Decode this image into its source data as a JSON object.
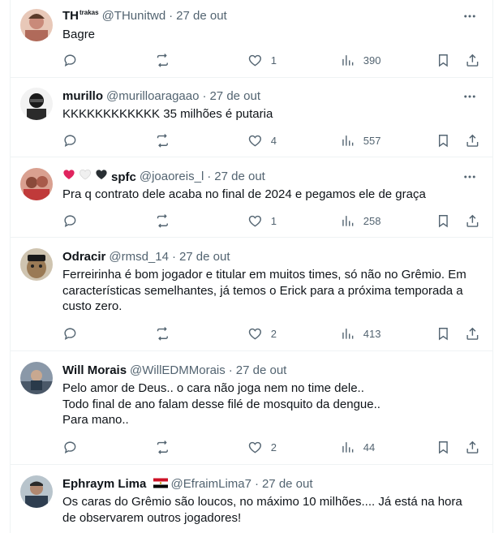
{
  "tweets": [
    {
      "name": "TH",
      "name_super": "trakas",
      "handle": "@THunitwd",
      "time": "27 de out",
      "lines": [
        "Bagre"
      ],
      "replies": "",
      "retweets": "",
      "likes": "1",
      "views": "390",
      "avatar_color": "#c98a7a"
    },
    {
      "name": "murillo",
      "handle": "@murilloaragaao",
      "time": "27 de out",
      "lines": [
        "KKKKKKKKKKKK 35 milhões é putaria"
      ],
      "replies": "",
      "retweets": "",
      "likes": "4",
      "views": "557",
      "avatar_color": "#2a2a2a"
    },
    {
      "name": "spfc",
      "name_emojis": [
        "red-heart",
        "white-heart",
        "black-heart"
      ],
      "handle": "@joaoreis_l",
      "time": "27 de out",
      "lines": [
        "Pra q contrato dele acaba no final de 2024 e pegamos ele de graça"
      ],
      "replies": "",
      "retweets": "",
      "likes": "1",
      "views": "258",
      "avatar_color": "#b0504a"
    },
    {
      "name": "Odracir",
      "handle": "@rmsd_14",
      "time": "27 de out",
      "lines": [
        "Ferreirinha é bom jogador e titular em muitos times, só não no Grêmio. Em",
        "características semelhantes, já temos o Erick para a próxima temporada a",
        "custo zero."
      ],
      "replies": "",
      "retweets": "",
      "likes": "2",
      "views": "413",
      "avatar_color": "#7a6a58"
    },
    {
      "name": "Will Morais",
      "handle": "@WillEDMMorais",
      "time": "27 de out",
      "lines": [
        "Pelo amor de Deus.. o cara não joga nem no time dele..",
        "Todo final de ano falam desse filé de mosquito da dengue..",
        "Para mano.."
      ],
      "replies": "",
      "retweets": "",
      "likes": "2",
      "views": "44",
      "avatar_color": "#5a6878"
    },
    {
      "name": "Ephraym Lima",
      "name_emojis": [
        "egypt-flag"
      ],
      "handle": "@EfraimLima7",
      "time": "27 de out",
      "lines": [
        "Os caras do Grêmio são loucos,  no máximo 10 milhões.... Já está na hora",
        "de observarem outros jogadores!"
      ],
      "replies": "",
      "retweets": "",
      "likes": "",
      "views": "",
      "avatar_color": "#4a5a6a"
    }
  ],
  "colors": {
    "text": "#0f1419",
    "secondary": "#536471",
    "border": "#eff3f4"
  }
}
